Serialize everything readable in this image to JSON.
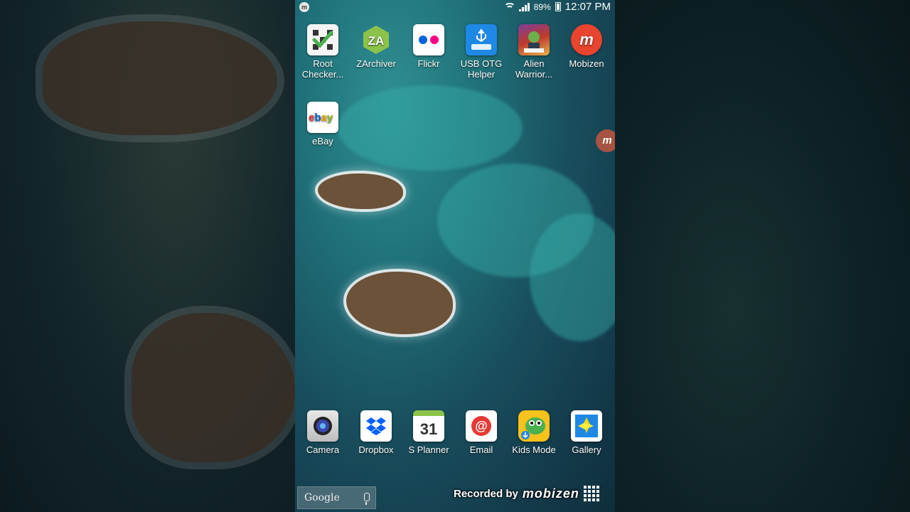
{
  "status_bar": {
    "notification_icon": "mobizen-icon",
    "battery_pct": "89%",
    "time": "12:07 PM"
  },
  "home_apps": [
    {
      "label": "Root\nChecker...",
      "icon": "root-checker-icon"
    },
    {
      "label": "ZArchiver",
      "icon": "zarchiver-icon"
    },
    {
      "label": "Flickr",
      "icon": "flickr-icon"
    },
    {
      "label": "USB OTG\nHelper",
      "icon": "usb-otg-icon"
    },
    {
      "label": "Alien\nWarrior...",
      "icon": "alien-warrior-icon"
    },
    {
      "label": "Mobizen",
      "icon": "mobizen-icon"
    },
    {
      "label": "eBay",
      "icon": "ebay-icon"
    }
  ],
  "dock_apps": [
    {
      "label": "Camera",
      "icon": "camera-icon"
    },
    {
      "label": "Dropbox",
      "icon": "dropbox-icon"
    },
    {
      "label": "S Planner",
      "icon": "calendar-icon",
      "icon_text": "31"
    },
    {
      "label": "Email",
      "icon": "email-icon",
      "icon_text": "@"
    },
    {
      "label": "Kids Mode",
      "icon": "kids-mode-icon"
    },
    {
      "label": "Gallery",
      "icon": "gallery-icon"
    }
  ],
  "search": {
    "label": "Google"
  },
  "watermark": {
    "prefix": "Recorded by",
    "brand": "mobizen"
  },
  "colors": {
    "mobizen": "#e8442e",
    "zarchiver": "#8bc34a",
    "flickr_pink": "#ff0084",
    "flickr_blue": "#0063dc",
    "usb": "#1e88e5"
  }
}
